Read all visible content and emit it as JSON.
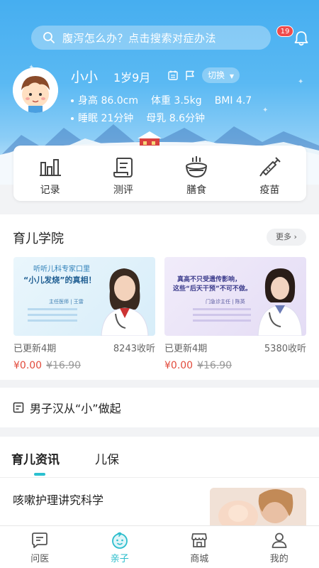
{
  "search": {
    "placeholder": "腹泻怎么办？点击搜索对症办法"
  },
  "notifications": {
    "count": "19"
  },
  "profile": {
    "name": "小小",
    "age": "1岁9月",
    "switch_label": "切换",
    "height": "身高 86.0cm",
    "weight": "体重 3.5kg",
    "bmi": "BMI 4.7",
    "sleep": "睡眠 21分钟",
    "breastmilk": "母乳 8.6分钟"
  },
  "quick_actions": [
    {
      "label": "记录",
      "icon": "bar-chart-icon"
    },
    {
      "label": "测评",
      "icon": "scroll-icon"
    },
    {
      "label": "膳食",
      "icon": "bowl-icon"
    },
    {
      "label": "疫苗",
      "icon": "syringe-icon"
    }
  ],
  "academy": {
    "title": "育儿学院",
    "more_label": "更多",
    "courses": [
      {
        "banner_line1": "听听儿科专家口里",
        "banner_line2": "“小儿发烧”的真相！",
        "doctor_label": "主任医师 | 王雷",
        "updated": "已更新4期",
        "listens": "8243收听",
        "price": "¥0.00",
        "original_price": "¥16.90"
      },
      {
        "banner_line1": "真高不只受遗传影响，",
        "banner_line2": "这些“后天干预”不可不做。",
        "doctor_label": "门急诊主任 | 陈英",
        "updated": "已更新4期",
        "listens": "5380收听",
        "price": "¥0.00",
        "original_price": "¥16.90"
      }
    ]
  },
  "article_link": {
    "title": "男子汉从“小”做起"
  },
  "news": {
    "tabs": [
      "育儿资讯",
      "儿保"
    ],
    "active_tab": 0,
    "item_title": "咳嗽护理讲究科学"
  },
  "bottom_nav": [
    {
      "label": "问医",
      "icon": "chat-doctor-icon"
    },
    {
      "label": "亲子",
      "icon": "baby-face-icon"
    },
    {
      "label": "商城",
      "icon": "store-icon"
    },
    {
      "label": "我的",
      "icon": "person-icon"
    }
  ],
  "colors": {
    "accent": "#2bbdcc",
    "price": "#e24a3b",
    "header_blue": "#46aef0"
  }
}
